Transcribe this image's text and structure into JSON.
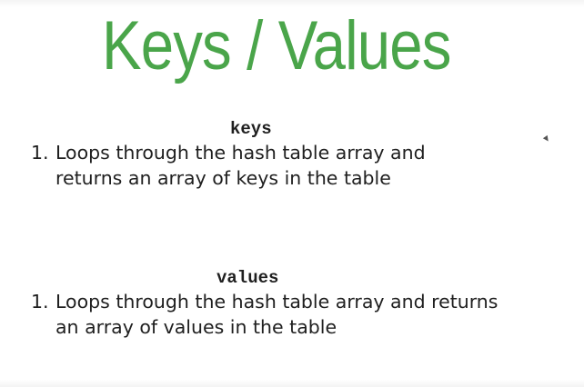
{
  "slide": {
    "title": "Keys / Values",
    "title_color": "#4aa54a",
    "sections": [
      {
        "heading": "keys",
        "item_number": "1.",
        "lines": [
          "Loops through the hash table array and",
          "returns an array of keys in the table"
        ]
      },
      {
        "heading": "values",
        "item_number": "1.",
        "lines": [
          "Loops through the hash table array and returns",
          "an array of values in the table"
        ]
      }
    ]
  }
}
